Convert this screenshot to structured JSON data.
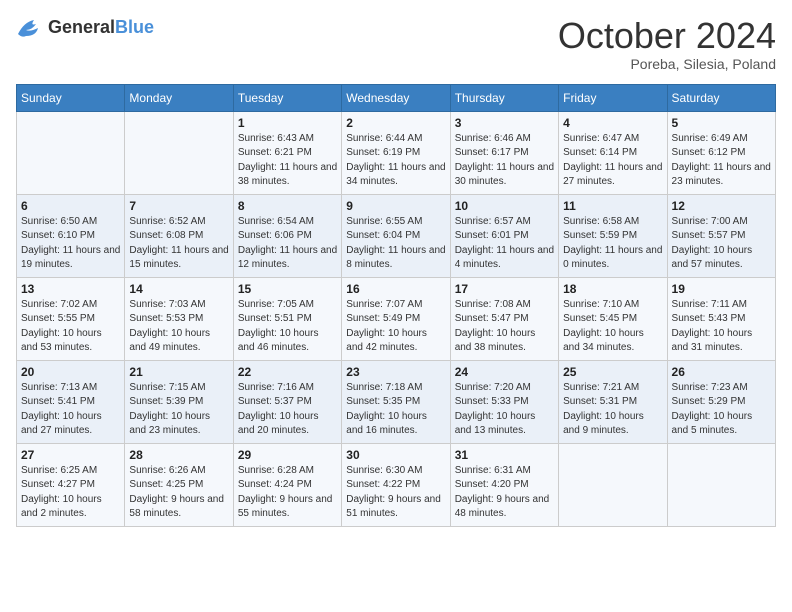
{
  "header": {
    "logo_general": "General",
    "logo_blue": "Blue",
    "month_title": "October 2024",
    "location": "Poreba, Silesia, Poland"
  },
  "days_of_week": [
    "Sunday",
    "Monday",
    "Tuesday",
    "Wednesday",
    "Thursday",
    "Friday",
    "Saturday"
  ],
  "weeks": [
    [
      {
        "day": "",
        "info": ""
      },
      {
        "day": "",
        "info": ""
      },
      {
        "day": "1",
        "info": "Sunrise: 6:43 AM\nSunset: 6:21 PM\nDaylight: 11 hours and 38 minutes."
      },
      {
        "day": "2",
        "info": "Sunrise: 6:44 AM\nSunset: 6:19 PM\nDaylight: 11 hours and 34 minutes."
      },
      {
        "day": "3",
        "info": "Sunrise: 6:46 AM\nSunset: 6:17 PM\nDaylight: 11 hours and 30 minutes."
      },
      {
        "day": "4",
        "info": "Sunrise: 6:47 AM\nSunset: 6:14 PM\nDaylight: 11 hours and 27 minutes."
      },
      {
        "day": "5",
        "info": "Sunrise: 6:49 AM\nSunset: 6:12 PM\nDaylight: 11 hours and 23 minutes."
      }
    ],
    [
      {
        "day": "6",
        "info": "Sunrise: 6:50 AM\nSunset: 6:10 PM\nDaylight: 11 hours and 19 minutes."
      },
      {
        "day": "7",
        "info": "Sunrise: 6:52 AM\nSunset: 6:08 PM\nDaylight: 11 hours and 15 minutes."
      },
      {
        "day": "8",
        "info": "Sunrise: 6:54 AM\nSunset: 6:06 PM\nDaylight: 11 hours and 12 minutes."
      },
      {
        "day": "9",
        "info": "Sunrise: 6:55 AM\nSunset: 6:04 PM\nDaylight: 11 hours and 8 minutes."
      },
      {
        "day": "10",
        "info": "Sunrise: 6:57 AM\nSunset: 6:01 PM\nDaylight: 11 hours and 4 minutes."
      },
      {
        "day": "11",
        "info": "Sunrise: 6:58 AM\nSunset: 5:59 PM\nDaylight: 11 hours and 0 minutes."
      },
      {
        "day": "12",
        "info": "Sunrise: 7:00 AM\nSunset: 5:57 PM\nDaylight: 10 hours and 57 minutes."
      }
    ],
    [
      {
        "day": "13",
        "info": "Sunrise: 7:02 AM\nSunset: 5:55 PM\nDaylight: 10 hours and 53 minutes."
      },
      {
        "day": "14",
        "info": "Sunrise: 7:03 AM\nSunset: 5:53 PM\nDaylight: 10 hours and 49 minutes."
      },
      {
        "day": "15",
        "info": "Sunrise: 7:05 AM\nSunset: 5:51 PM\nDaylight: 10 hours and 46 minutes."
      },
      {
        "day": "16",
        "info": "Sunrise: 7:07 AM\nSunset: 5:49 PM\nDaylight: 10 hours and 42 minutes."
      },
      {
        "day": "17",
        "info": "Sunrise: 7:08 AM\nSunset: 5:47 PM\nDaylight: 10 hours and 38 minutes."
      },
      {
        "day": "18",
        "info": "Sunrise: 7:10 AM\nSunset: 5:45 PM\nDaylight: 10 hours and 34 minutes."
      },
      {
        "day": "19",
        "info": "Sunrise: 7:11 AM\nSunset: 5:43 PM\nDaylight: 10 hours and 31 minutes."
      }
    ],
    [
      {
        "day": "20",
        "info": "Sunrise: 7:13 AM\nSunset: 5:41 PM\nDaylight: 10 hours and 27 minutes."
      },
      {
        "day": "21",
        "info": "Sunrise: 7:15 AM\nSunset: 5:39 PM\nDaylight: 10 hours and 23 minutes."
      },
      {
        "day": "22",
        "info": "Sunrise: 7:16 AM\nSunset: 5:37 PM\nDaylight: 10 hours and 20 minutes."
      },
      {
        "day": "23",
        "info": "Sunrise: 7:18 AM\nSunset: 5:35 PM\nDaylight: 10 hours and 16 minutes."
      },
      {
        "day": "24",
        "info": "Sunrise: 7:20 AM\nSunset: 5:33 PM\nDaylight: 10 hours and 13 minutes."
      },
      {
        "day": "25",
        "info": "Sunrise: 7:21 AM\nSunset: 5:31 PM\nDaylight: 10 hours and 9 minutes."
      },
      {
        "day": "26",
        "info": "Sunrise: 7:23 AM\nSunset: 5:29 PM\nDaylight: 10 hours and 5 minutes."
      }
    ],
    [
      {
        "day": "27",
        "info": "Sunrise: 6:25 AM\nSunset: 4:27 PM\nDaylight: 10 hours and 2 minutes."
      },
      {
        "day": "28",
        "info": "Sunrise: 6:26 AM\nSunset: 4:25 PM\nDaylight: 9 hours and 58 minutes."
      },
      {
        "day": "29",
        "info": "Sunrise: 6:28 AM\nSunset: 4:24 PM\nDaylight: 9 hours and 55 minutes."
      },
      {
        "day": "30",
        "info": "Sunrise: 6:30 AM\nSunset: 4:22 PM\nDaylight: 9 hours and 51 minutes."
      },
      {
        "day": "31",
        "info": "Sunrise: 6:31 AM\nSunset: 4:20 PM\nDaylight: 9 hours and 48 minutes."
      },
      {
        "day": "",
        "info": ""
      },
      {
        "day": "",
        "info": ""
      }
    ]
  ]
}
